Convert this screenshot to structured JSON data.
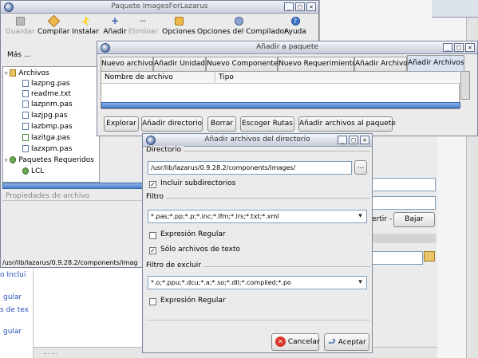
{
  "main_window": {
    "title": "Paquete ImagesForLazarus",
    "toolbar": {
      "guardar": "Guardar",
      "compilar": "Compilar",
      "instalar": "Instalar",
      "anadir": "Añadir",
      "eliminar": "Eliminar",
      "opciones": "Opciones",
      "opciones_compilador": "Opciones del Compilador",
      "ayuda": "Ayuda"
    },
    "mas": "Más ...",
    "tree": {
      "archivos": "Archivos",
      "files": [
        "lazpng.pas",
        "readme.txt",
        "lazpnm.pas",
        "lazjpg.pas",
        "lazbmp.pas",
        "lazitga.pas",
        "lazxpm.pas"
      ],
      "requeridos": "Paquetes Requeridos",
      "lcl": "LCL"
    },
    "props_label": "Propiedades de archivo",
    "status_path": "/usr/lib/lazarus/0.9.28.2/components/imag"
  },
  "add_window": {
    "title": "Añadir a paquete",
    "tabs": [
      "Nuevo archivo",
      "Añadir Unidad",
      "Nuevo Componente",
      "Nuevo Requerimiento",
      "Añadir Archivo",
      "Añadir Archivos"
    ],
    "columns": [
      "Nombre de archivo",
      "Tipo"
    ],
    "buttons": {
      "explorar": "Explorar",
      "anadir_dir": "Añadir directorio",
      "borrar": "Borrar",
      "escoger": "Escoger Rutas",
      "anadir_paquete": "Añadir archivos al paquete"
    },
    "bajar": "Bajar",
    "partial_ertir": "ertir -"
  },
  "dir_dialog": {
    "title": "Añadir archivos del directorio",
    "directorio_label": "Directorio",
    "directorio_value": "/usr/lib/lazarus/0.9.28.2/components/images/",
    "browse": "...",
    "incluir_sub": "Incluir subdirectorios",
    "filtro_label": "Filtro",
    "filtro_value": "*.pas;*.pp;*.p;*.inc;*.lfm;*.lrs;*.txt;*.xml",
    "expresion1": "Expresión Regular",
    "solo_texto": "Sólo archivos de texto",
    "excluir_label": "Filtro de excluir",
    "excluir_value": "*.o;*.ppu;*.dcu;*.a;*.so;*.dll;*.compiled;*.po",
    "expresion2": "Expresión Regular",
    "cancelar": "Cancelar",
    "aceptar": "Aceptar",
    "incluir_sub_checked": true,
    "solo_texto_checked": true,
    "expresion1_checked": false,
    "expresion2_checked": false
  },
  "background": {
    "left_fragments": [
      "o Inclui",
      "gular",
      "s de tex",
      "gular"
    ],
    "bottom": "... ..."
  }
}
